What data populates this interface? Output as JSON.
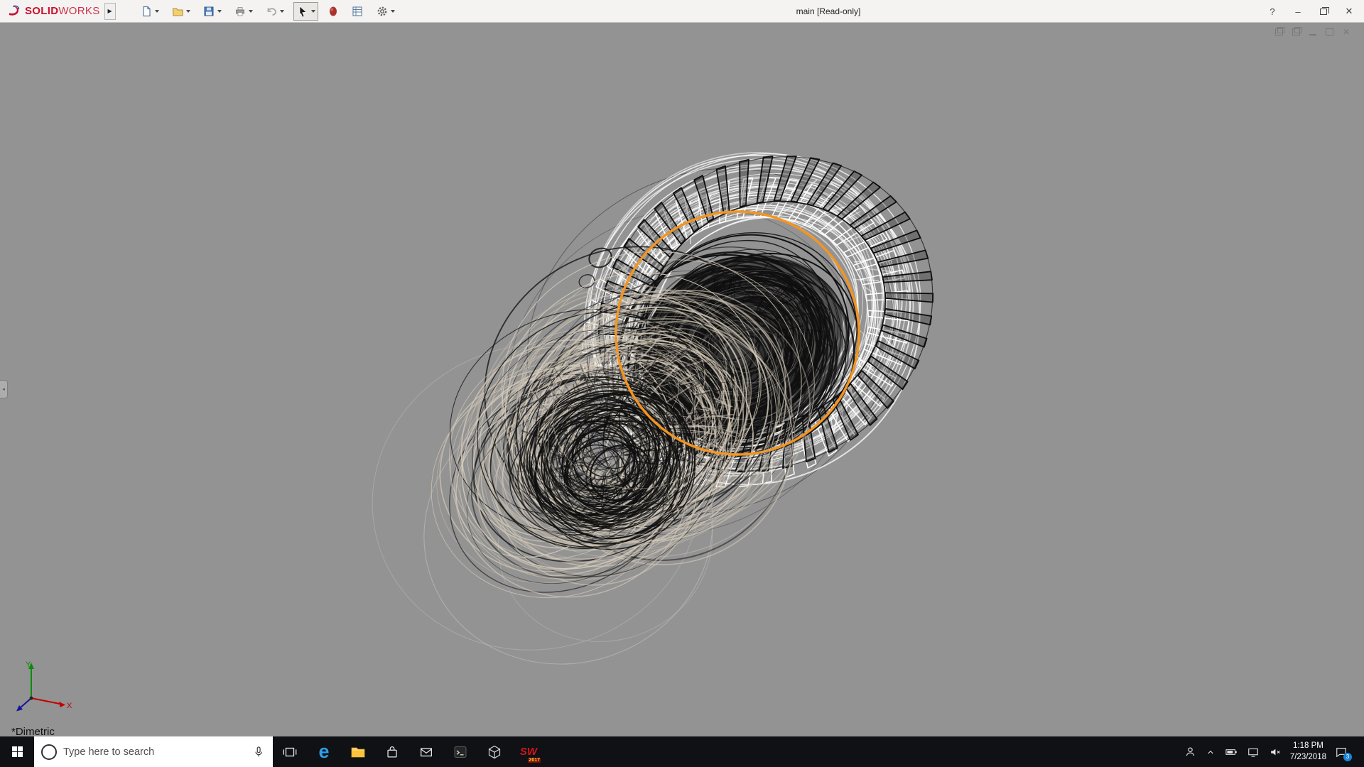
{
  "titlebar": {
    "brand_bold": "SOLID",
    "brand_light": "WORKS",
    "flyout_glyph": "▶",
    "document_title": "main [Read-only]",
    "help_glyph": "?",
    "minimize_glyph": "–",
    "close_glyph": "✕"
  },
  "toolbar": {
    "items": [
      "new-document",
      "open",
      "save",
      "print",
      "undo",
      "select",
      "appearances",
      "file-properties",
      "options"
    ]
  },
  "viewport": {
    "view_orientation_label": "*Dimetric",
    "background_color": "#939393",
    "colors": {
      "highlight_orange": "#f5941e",
      "wire_beige": "#d8cec0",
      "wire_beige2": "#cfc5b4",
      "wire_beige3": "#c6bcaa",
      "wire_black": "#101010",
      "wire_white": "#ffffff",
      "ghost": "#c6c6c6"
    },
    "triad": {
      "x_label": "X",
      "y_label": "Y"
    }
  },
  "taskbar": {
    "search_placeholder": "Type here to search",
    "solidworks_label": "SW",
    "solidworks_year": "2017",
    "tray": {
      "time": "1:18 PM",
      "date": "7/23/2018",
      "badge_count": "3"
    }
  }
}
